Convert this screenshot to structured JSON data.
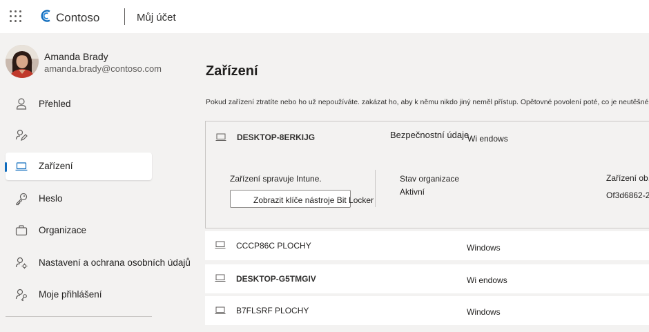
{
  "header": {
    "brand": "Contoso",
    "app_title": "Můj účet"
  },
  "user": {
    "name": "Amanda Brady",
    "email": "amanda.brady@contoso.com"
  },
  "nav": {
    "items": [
      {
        "label": "Přehled",
        "icon": "person-icon"
      },
      {
        "label": "",
        "icon": "person-edit-icon"
      },
      {
        "label": "Zařízení",
        "icon": "laptop-icon",
        "active": true
      },
      {
        "label": "Heslo",
        "icon": "key-icon"
      },
      {
        "label": "Organizace",
        "icon": "briefcase-icon"
      },
      {
        "label": "Nastavení a ochrana osobních údajů",
        "icon": "person-settings-icon"
      },
      {
        "label": "Moje přihlášení",
        "icon": "person-key-icon"
      }
    ]
  },
  "main": {
    "title": "Zařízení",
    "description": "Pokud zařízení ztratíte nebo ho už nepoužíváte. zakázat ho, aby k němu nikdo jiný neměl přístup. Opětovné povolení poté, co je neutěšné",
    "expanded_device": {
      "name": "DESKTOP-8ERKIJG",
      "security_label": "Bezpečnostní údaje",
      "os": "Wi endows",
      "managed_text": "Zařízení spravuje Intune.",
      "bitlocker_button": "Zobrazit klíče nástroje Bit Locker",
      "org_status_label": "Stav organizace",
      "org_status_value": "Aktivní",
      "device_id_label": "Zařízení ob.",
      "device_id_value": "Of3d6862-2"
    },
    "devices": [
      {
        "name": "CCCP86C PLOCHY",
        "os": "Windows"
      },
      {
        "name": "DESKTOP-G5TMGIV",
        "os": "Wi endows"
      },
      {
        "name": "B7FLSRF PLOCHY",
        "os": "Windows"
      }
    ]
  },
  "colors": {
    "accent": "#0f6cbd",
    "background": "#f3f2f1",
    "surface": "#ffffff"
  }
}
